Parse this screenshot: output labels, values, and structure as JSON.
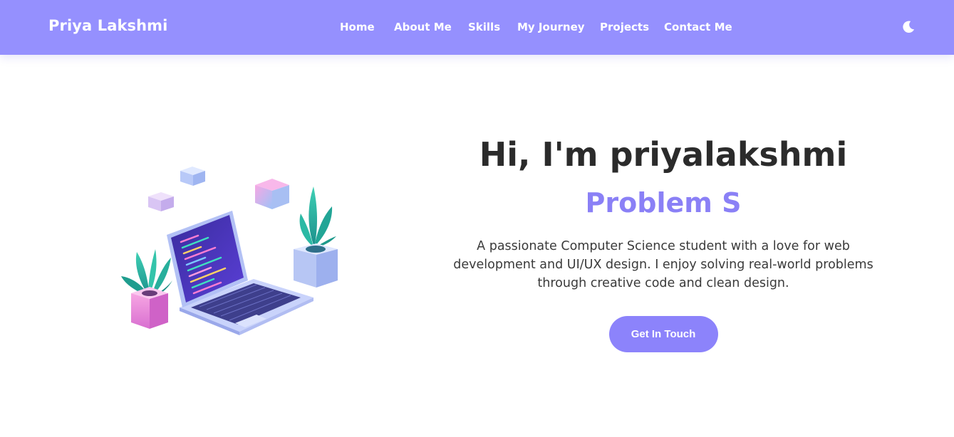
{
  "navbar": {
    "brand": "Priya Lakshmi",
    "links": [
      {
        "label": "Home"
      },
      {
        "label": "About Me"
      },
      {
        "label": "Skills"
      },
      {
        "label": "My Journey"
      },
      {
        "label": "Projects"
      },
      {
        "label": "Contact Me"
      }
    ],
    "theme_toggle_icon": "moon-icon",
    "background_color": "#9590fe"
  },
  "hero": {
    "title": "Hi, I'm priyalakshmi",
    "subtitle": "Problem S",
    "description": "A passionate Computer Science student with a love for web development and UI/UX design. I enjoy solving real-world problems through creative code and clean design.",
    "cta_label": "Get In Touch",
    "accent_color": "#8c83fb",
    "illustration": "laptop-with-plants-illustration"
  }
}
